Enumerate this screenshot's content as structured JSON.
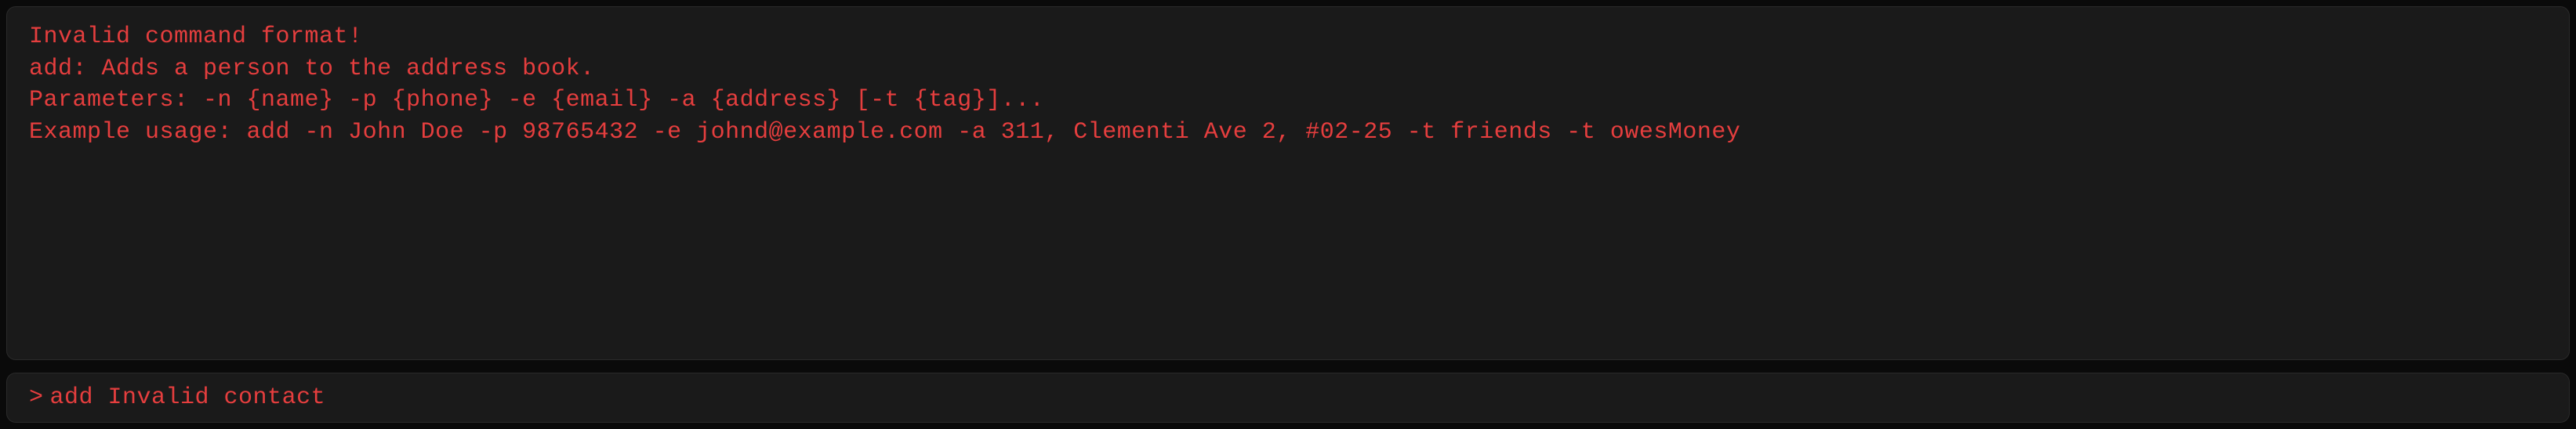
{
  "output": {
    "error_header": "Invalid command format!",
    "command_desc": "add: Adds a person to the address book.",
    "parameters": "Parameters: -n {name} -p {phone} -e {email} -a {address} [-t {tag}]...",
    "example": "Example usage: add -n John Doe -p 98765432 -e johnd@example.com -a 311, Clementi Ave 2, #02-25 -t friends -t owesMoney"
  },
  "input": {
    "prompt": ">",
    "command_value": "add Invalid contact"
  },
  "colors": {
    "background": "#0a0a0a",
    "panel": "#1a1a1a",
    "border": "#2a2a2a",
    "text": "#e53e3e"
  }
}
